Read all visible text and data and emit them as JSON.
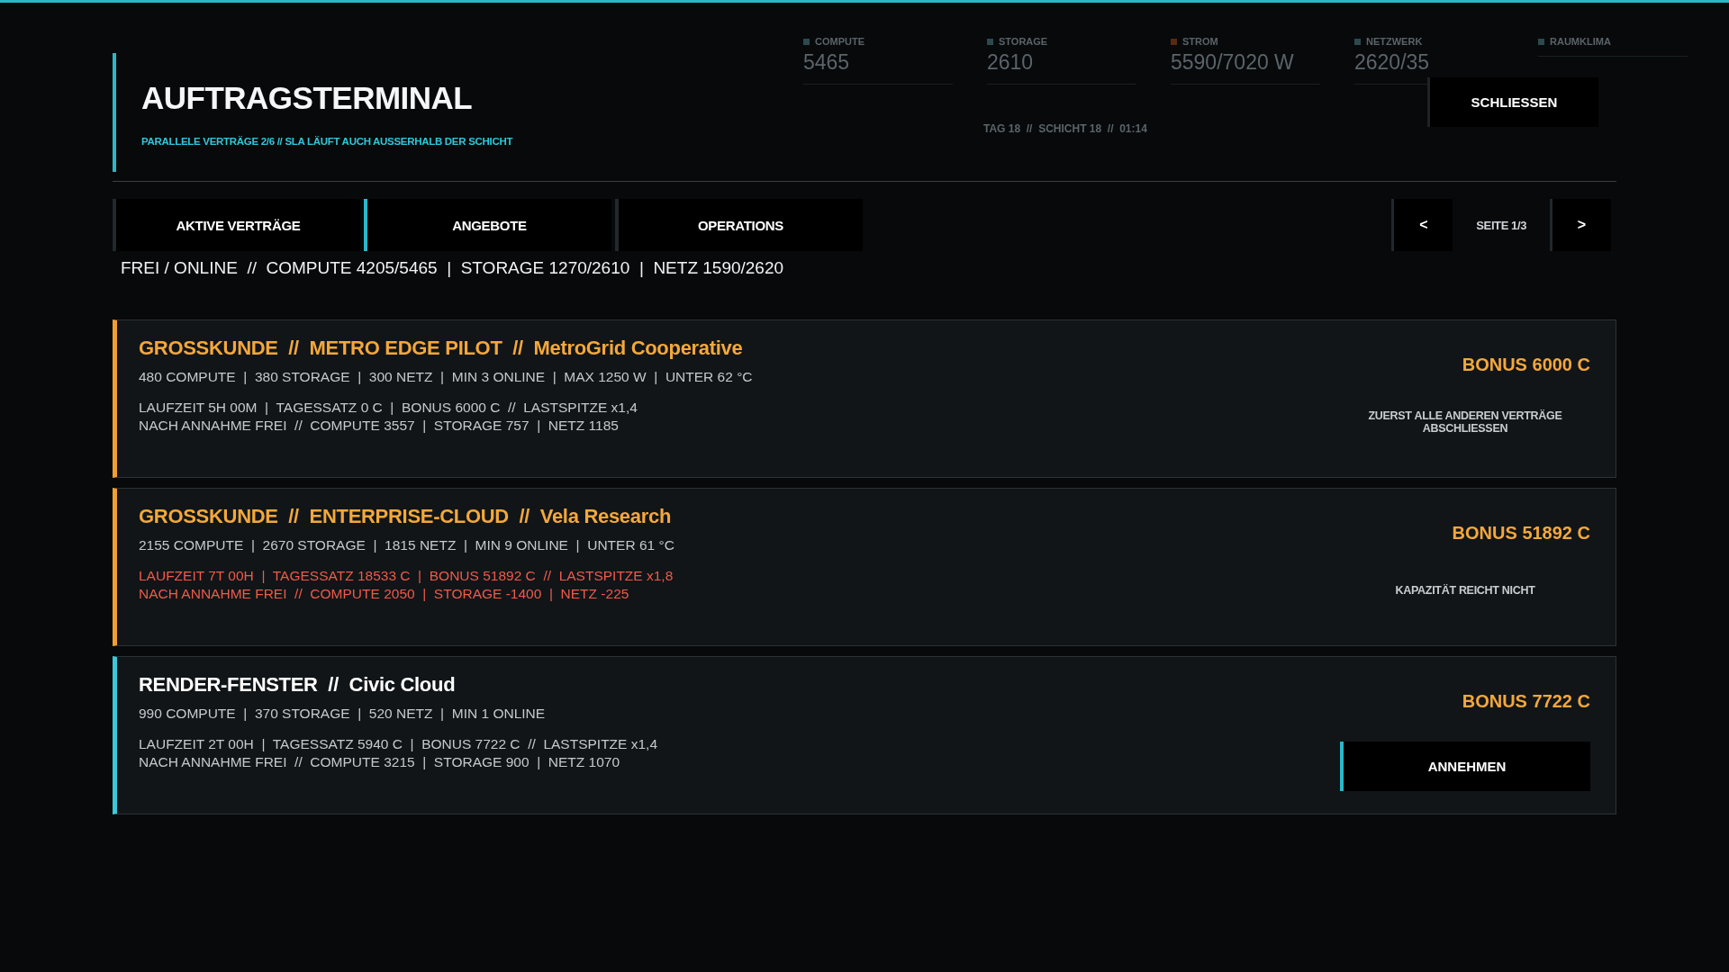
{
  "background": {
    "stats": [
      {
        "label": "COMPUTE",
        "value": "5465",
        "color": "#2c4a4e"
      },
      {
        "label": "STORAGE",
        "value": "2610",
        "color": "#2c4a4e"
      },
      {
        "label": "STROM",
        "value": "5590/7020 W",
        "color": "#5a2a10"
      },
      {
        "label": "NETZWERK",
        "value": "2620/35",
        "color": "#2c4a4e"
      },
      {
        "label": "RAUMKLIMA",
        "color": "#2c4a4e"
      }
    ],
    "clock": "TAG 18  //  SCHICHT 18  //  01:14"
  },
  "header": {
    "title": "AUFTRAGSTERMINAL",
    "subtitle": "PARALLELE VERTRÄGE 2/6 // SLA LÄUFT AUCH AUSSERHALB DER SCHICHT",
    "close_button": "SCHLIESSEN"
  },
  "tabs": [
    {
      "label": "AKTIVE VERTRÄGE",
      "selected": false
    },
    {
      "label": "ANGEBOTE",
      "selected": true
    },
    {
      "label": "OPERATIONS",
      "selected": false
    }
  ],
  "pager": {
    "prev": "<",
    "page": "SEITE 1/3",
    "next": ">"
  },
  "capacity": "FREI / ONLINE  //  COMPUTE 4205/5465  |  STORAGE 1270/2610  |  NETZ 1590/2620",
  "contracts": [
    {
      "title": "GROSSKUNDE  //  METRO EDGE PILOT  //  MetroGrid Cooperative",
      "premium": true,
      "color": "#f0a030",
      "specs": "480 COMPUTE  |  380 STORAGE  |  300 NETZ  |  MIN 3 ONLINE  |  MAX 1250 W  |  UNTER 62 °C",
      "details": [
        "LAUFZEIT 5H 00M  |  TAGESSATZ 0 C  |  BONUS 6000 C  //  LASTSPITZE x1,4",
        "NACH ANNAHME FREI  //  COMPUTE 3557  |  STORAGE 757  |  NETZ 1185"
      ],
      "warning": false,
      "bonus": "BONUS 6000 C",
      "action": {
        "kind": "note",
        "text": "ZUERST ALLE ANDEREN VERTRÄGE ABSCHLIESSEN"
      }
    },
    {
      "title": "GROSSKUNDE  //  ENTERPRISE-CLOUD  //  Vela Research",
      "premium": true,
      "color": "#f0a030",
      "specs": "2155 COMPUTE  |  2670 STORAGE  |  1815 NETZ  |  MIN 9 ONLINE  |  UNTER 61 °C",
      "details": [
        "LAUFZEIT 7T 00H  |  TAGESSATZ 18533 C  |  BONUS 51892 C  //  LASTSPITZE x1,8",
        "NACH ANNAHME FREI  //  COMPUTE 2050  |  STORAGE -1400  |  NETZ -225"
      ],
      "warning": true,
      "bonus": "BONUS 51892 C",
      "action": {
        "kind": "note",
        "text": "KAPAZITÄT REICHT NICHT"
      }
    },
    {
      "title": "RENDER-FENSTER  //  Civic Cloud",
      "premium": false,
      "color": "#3cc8d8",
      "specs": "990 COMPUTE  |  370 STORAGE  |  520 NETZ  |  MIN 1 ONLINE",
      "details": [
        "LAUFZEIT 2T 00H  |  TAGESSATZ 5940 C  |  BONUS 7722 C  //  LASTSPITZE x1,4",
        "NACH ANNAHME FREI  //  COMPUTE 3215  |  STORAGE 900  |  NETZ 1070"
      ],
      "warning": false,
      "bonus": "BONUS 7722 C",
      "action": {
        "kind": "button",
        "text": "ANNEHMEN"
      }
    }
  ]
}
